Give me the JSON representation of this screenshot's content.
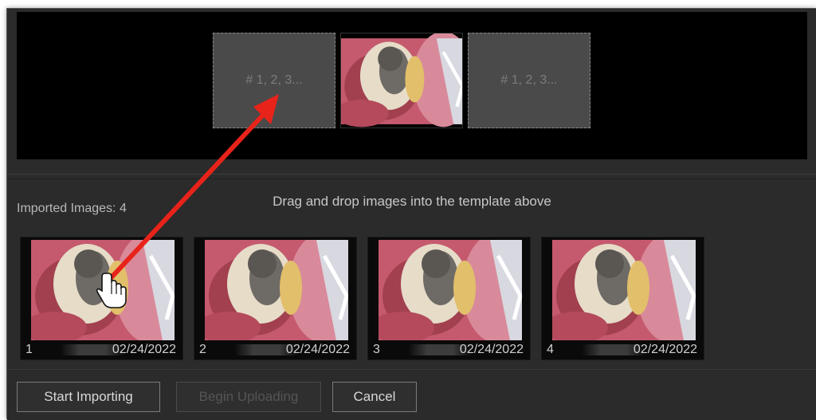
{
  "template": {
    "slots": [
      {
        "kind": "empty",
        "placeholder": "# 1, 2, 3..."
      },
      {
        "kind": "image",
        "image": "dental-intraoral-photo"
      },
      {
        "kind": "empty",
        "placeholder": "# 1, 2, 3..."
      }
    ]
  },
  "instructions": "Drag and drop images into the template above",
  "imported": {
    "label": "Imported Images:",
    "count": "4"
  },
  "thumbnails": [
    {
      "index": "1",
      "date": "02/24/2022"
    },
    {
      "index": "2",
      "date": "02/24/2022"
    },
    {
      "index": "3",
      "date": "02/24/2022"
    },
    {
      "index": "4",
      "date": "02/24/2022"
    }
  ],
  "buttons": {
    "start_importing": "Start Importing",
    "begin_uploading": "Begin Uploading",
    "cancel": "Cancel"
  },
  "annotation": {
    "arrow_color": "#e8231a",
    "cursor": "hand-pointer-icon"
  }
}
